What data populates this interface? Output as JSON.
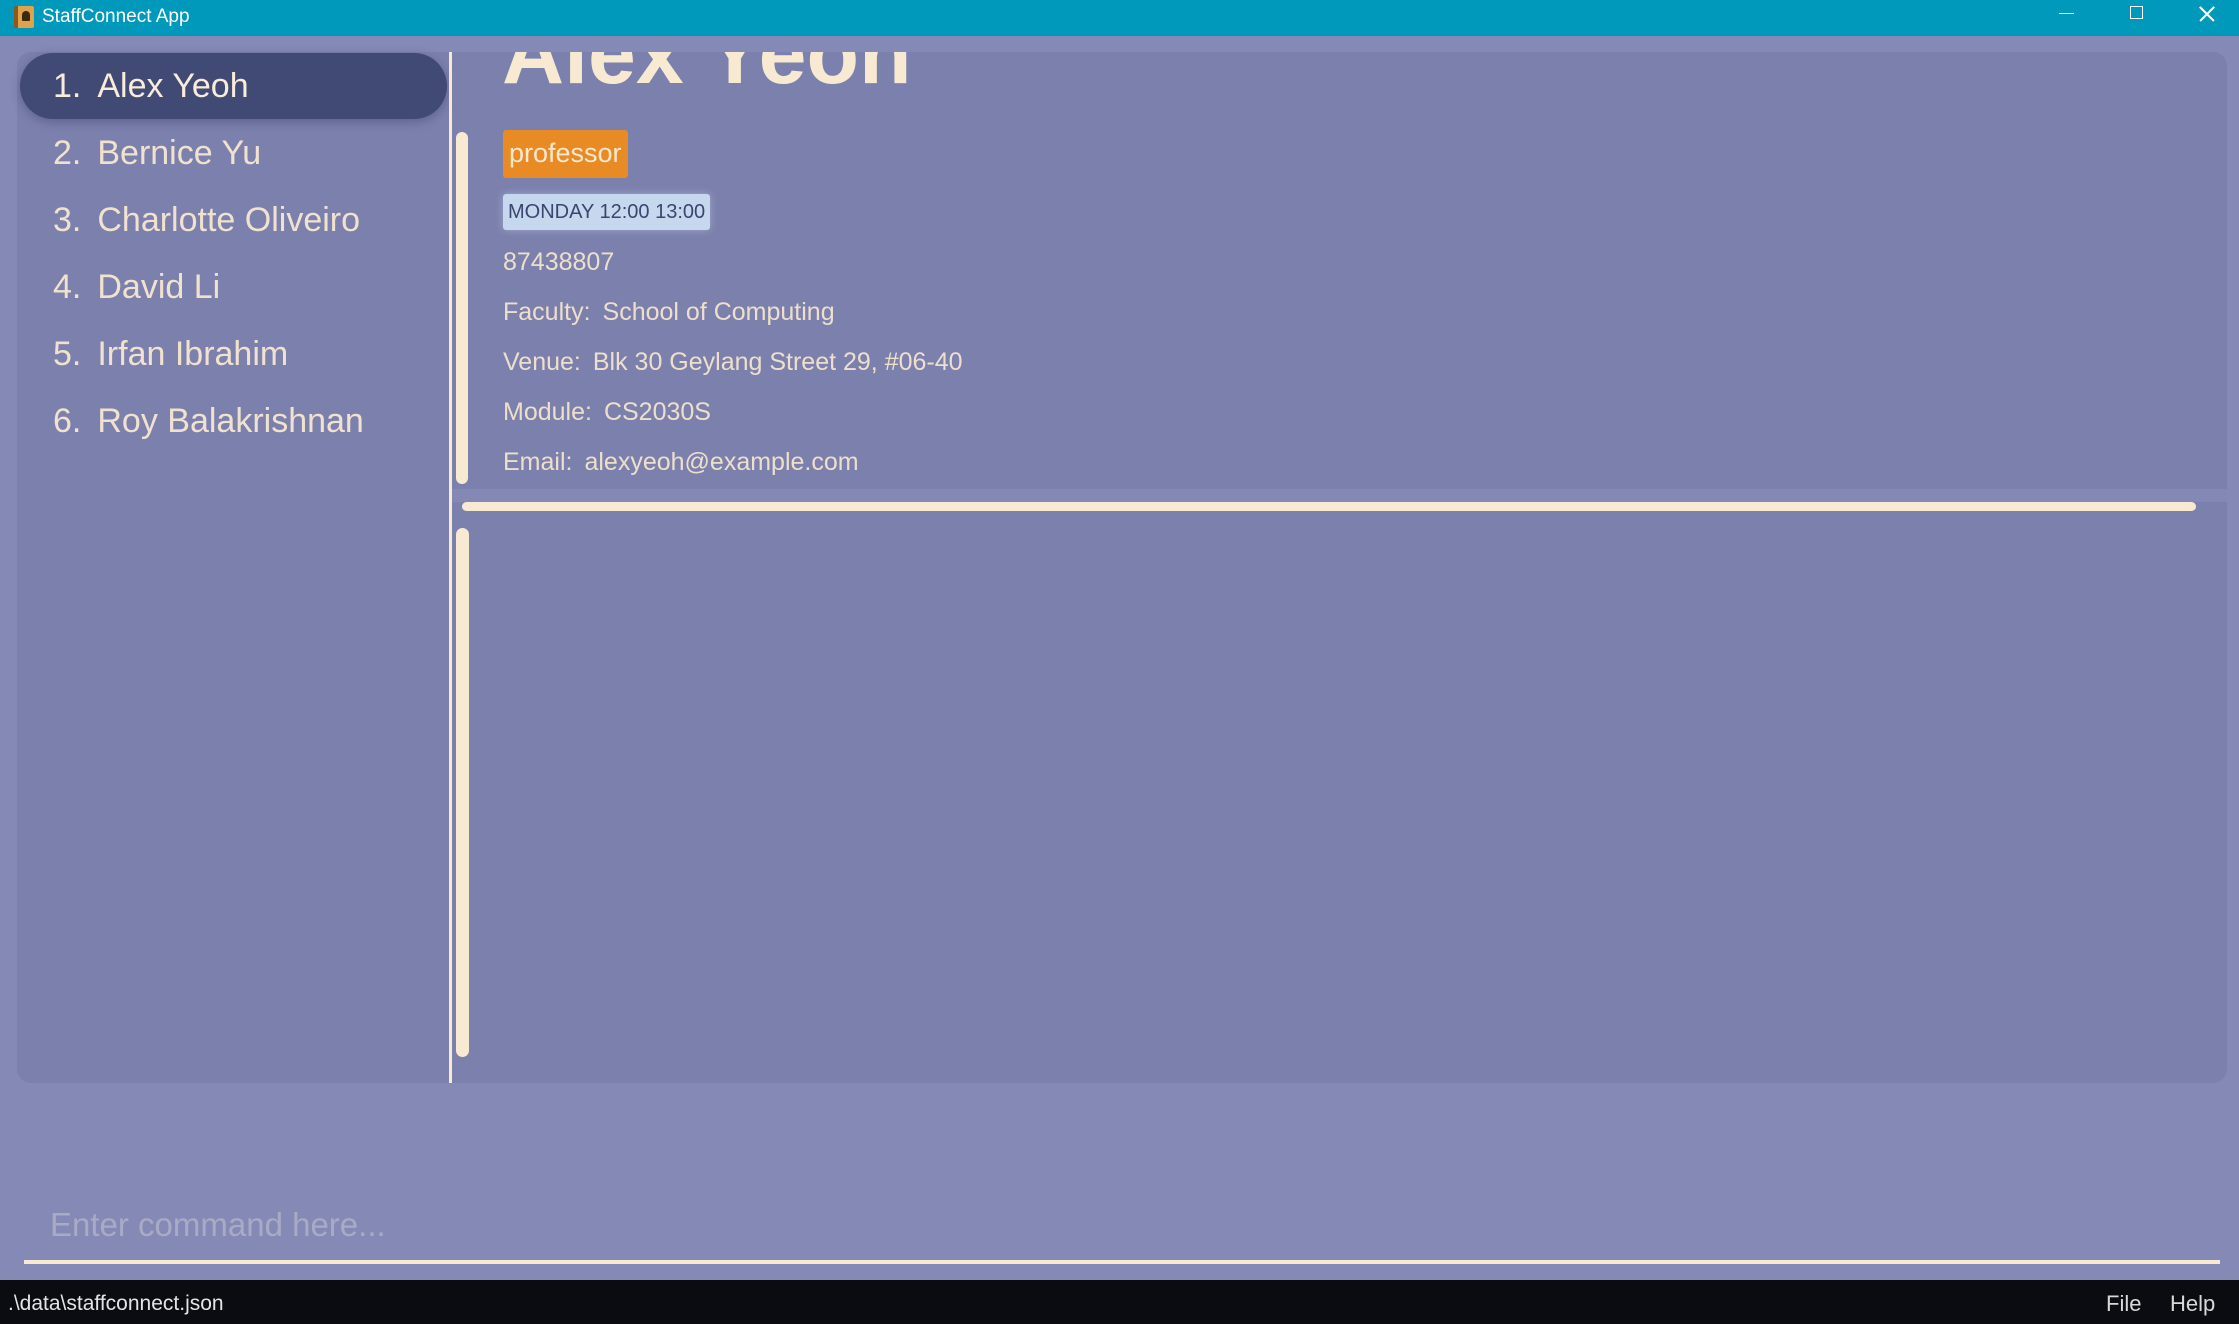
{
  "window": {
    "title": "StaffConnect App",
    "icon": "address-book-icon",
    "controls": [
      "minimize-icon",
      "maximize-icon",
      "close-icon"
    ]
  },
  "colors": {
    "titlebar": "#0099BB",
    "background": "#8589B5",
    "panel": "#7C80AC",
    "selected_item": "#414A74",
    "accent_cream": "#F8EAD2",
    "role_tag": "#E88B25",
    "time_tag": "#C6D8EE",
    "statusbar": "#0B0C12"
  },
  "staff_list": {
    "selected_index": 0,
    "items": [
      {
        "index": "1.",
        "name": "Alex Yeoh"
      },
      {
        "index": "2.",
        "name": "Bernice Yu"
      },
      {
        "index": "3.",
        "name": "Charlotte Oliveiro"
      },
      {
        "index": "4.",
        "name": "David Li"
      },
      {
        "index": "5.",
        "name": "Irfan Ibrahim"
      },
      {
        "index": "6.",
        "name": "Roy Balakrishnan"
      }
    ]
  },
  "detail": {
    "name": "Alex Yeoh",
    "tag": "professor",
    "availability": "MONDAY 12:00 13:00",
    "phone": "87438807",
    "fields": [
      {
        "label": "Faculty:",
        "value": "School of Computing"
      },
      {
        "label": "Venue:",
        "value": "Blk 30 Geylang Street 29, #06-40"
      },
      {
        "label": "Module:",
        "value": "CS2030S"
      },
      {
        "label": "Email:",
        "value": "alexyeoh@example.com"
      }
    ]
  },
  "command": {
    "value": "",
    "placeholder": "Enter command here..."
  },
  "statusbar": {
    "file_path": ".\\data\\staffconnect.json",
    "menu": [
      "File",
      "Help"
    ]
  }
}
